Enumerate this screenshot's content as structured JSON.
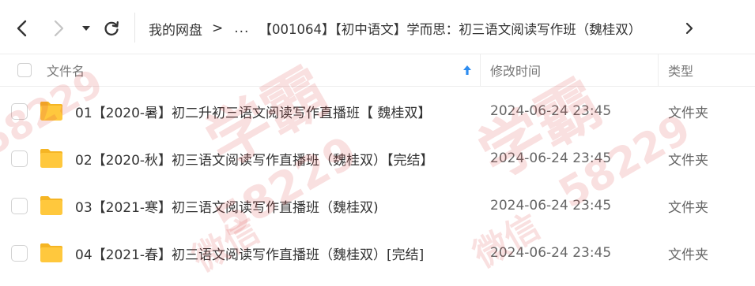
{
  "toolbar": {
    "icons": [
      "arrow-left-icon",
      "arrow-right-icon",
      "caret-down-icon",
      "refresh-icon",
      "chevron-right-icon"
    ]
  },
  "breadcrumb": {
    "root": "我的网盘",
    "separator": ">",
    "ellipsis": "...",
    "current": "【001064】【初中语文】学而思：初三语文阅读写作班（魏桂双）",
    "next_separator": ">"
  },
  "table": {
    "columns": {
      "name": "文件名",
      "modified": "修改时间",
      "type": "类型"
    },
    "sort_indicator": "up-arrow-icon",
    "rows": [
      {
        "name": "01【2020-暑】初二升初三语文阅读写作直播班【 魏桂双】",
        "modified": "2024-06-24 23:45",
        "type": "文件夹"
      },
      {
        "name": "02【2020-秋】初三语文阅读写作直播班（魏桂双）【完结】",
        "modified": "2024-06-24 23:45",
        "type": "文件夹"
      },
      {
        "name": "03【2021-寒】初三语文阅读写作直播班（魏桂双)",
        "modified": "2024-06-24 23:45",
        "type": "文件夹"
      },
      {
        "name": "04【2021-春】初三语文阅读写作直播班（魏桂双）[完结]",
        "modified": "2024-06-24 23:45",
        "type": "文件夹"
      }
    ]
  },
  "watermark": {
    "text_a": "学霸",
    "text_b": "微信",
    "number": "58229",
    "color": "#dc3c3c"
  },
  "colors": {
    "folder": "#ffc83d",
    "folder_back": "#f5b524",
    "sort_arrow": "#2d8cf0"
  }
}
